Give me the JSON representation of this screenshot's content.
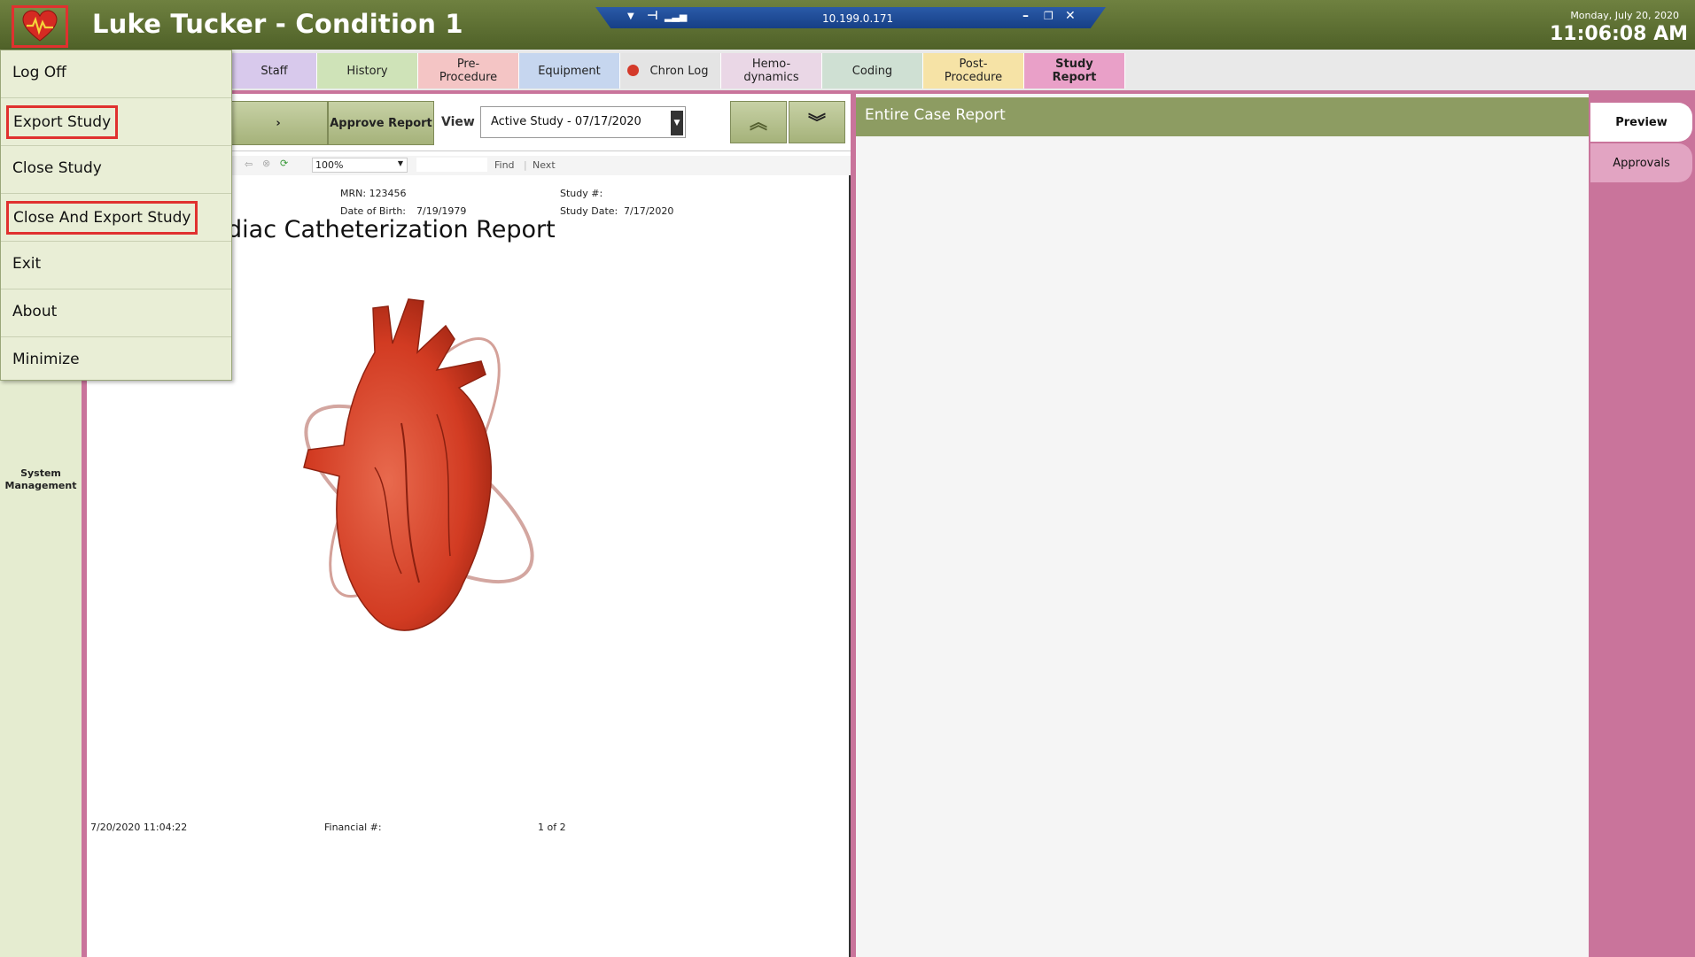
{
  "window": {
    "title": "Luke Tucker - Condition 1",
    "remote_ip": "10.199.0.171",
    "date": "Monday, July 20, 2020",
    "time": "11:06:08 AM"
  },
  "tabs": [
    {
      "label": "Staff",
      "color": "#d8c9ec"
    },
    {
      "label": "History",
      "color": "#cfe3b8"
    },
    {
      "label": "Pre-\nProcedure",
      "color": "#f4c5c5"
    },
    {
      "label": "Equipment",
      "color": "#c6d6ef"
    },
    {
      "label": "Chron Log",
      "color": "#e4e4e4"
    },
    {
      "label": "Hemo-\ndynamics",
      "color": "#ead7e6"
    },
    {
      "label": "Coding",
      "color": "#cfe0d3"
    },
    {
      "label": "Post-\nProcedure",
      "color": "#f6e3a6"
    },
    {
      "label": "Study\nReport",
      "color": "#e9a0c8"
    }
  ],
  "sidebar": {
    "system_management": "System Management"
  },
  "menu": {
    "items": [
      "Log Off",
      "Export Study",
      "Close Study",
      "Close And Export Study",
      "Exit",
      "About",
      "Minimize"
    ]
  },
  "report_toolbar": {
    "approve_label": "Approve Report",
    "view_label": "View",
    "view_value": "Active Study - 07/17/2020",
    "zoom": "100%",
    "find": "Find",
    "next": "Next"
  },
  "report": {
    "mrn": "MRN: 123456",
    "study_no": "Study #:",
    "dob_label": "Date of Birth:",
    "dob_value": "7/19/1979",
    "study_date_label": "Study Date:",
    "study_date_value": "7/17/2020",
    "title": "Cardiac Catheterization Report",
    "footer_timestamp": "7/20/2020 11:04:22",
    "footer_financial": "Financial #:",
    "footer_page": "1 of 2"
  },
  "right_pane": {
    "header": "Entire Case Report",
    "tabs": [
      "Preview",
      "Approvals"
    ]
  },
  "colors": {
    "olive": "#4f6128",
    "pink_frame": "#c9749b",
    "highlight": "#e0312f"
  }
}
